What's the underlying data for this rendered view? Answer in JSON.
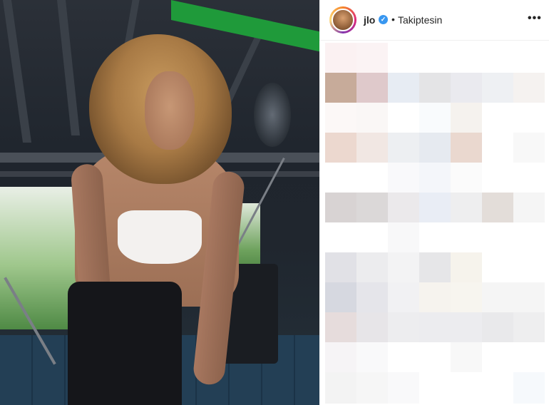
{
  "post": {
    "username": "jlo",
    "verified_mark": "✓",
    "separator": "•",
    "follow_status": "Takiptesin",
    "more_icon": "•••"
  },
  "icons": [
    "verified-badge-icon",
    "more-options-icon"
  ],
  "colors": {
    "verified_blue": "#3897f0",
    "text": "#262626",
    "green_beam": "#1f9a3a"
  },
  "blurred_rows": [
    [
      "#fbf1f2",
      "#fbf3f4",
      "#ffffff",
      "#ffffff",
      "#ffffff",
      "#ffffff",
      "#ffffff"
    ],
    [
      "#c7ab9a",
      "#dfc9cb",
      "#e7ecf3",
      "#e4e4e6",
      "#eaeaef",
      "#eef0f3",
      "#f5f2f0"
    ],
    [
      "#fcf8f7",
      "#faf7f6",
      "#ffffff",
      "#f9fbfd",
      "#f5f2ee",
      "#ffffff",
      "#ffffff"
    ],
    [
      "#ecd8cf",
      "#f1e7e3",
      "#edeff2",
      "#e6eaf0",
      "#ead8cf",
      "#ffffff",
      "#f8f8f8"
    ],
    [
      "#ffffff",
      "#ffffff",
      "#f9f9fb",
      "#f4f6fa",
      "#fbfbfb",
      "#ffffff",
      "#ffffff"
    ],
    [
      "#d8d3d3",
      "#dbd8d8",
      "#ebe9eb",
      "#e9edf5",
      "#eeeeef",
      "#e3ddd9",
      "#f5f5f5"
    ],
    [
      "#ffffff",
      "#ffffff",
      "#f8f8f9",
      "#ffffff",
      "#ffffff",
      "#ffffff",
      "#ffffff"
    ],
    [
      "#e1e1e6",
      "#ececee",
      "#f3f3f4",
      "#e6e6e8",
      "#f6f3ec",
      "#ffffff",
      "#ffffff"
    ],
    [
      "#d6d8e0",
      "#e5e5ea",
      "#f1f1f3",
      "#f6f3ee",
      "#f7f5ef",
      "#f5f5f5",
      "#f5f5f5"
    ],
    [
      "#e6dcdc",
      "#e7e5e8",
      "#ededef",
      "#ececef",
      "#ececef",
      "#e9e9eb",
      "#eeeeef"
    ],
    [
      "#f6f4f6",
      "#f9f9fa",
      "#ffffff",
      "#ffffff",
      "#f8f8f8",
      "#ffffff",
      "#ffffff"
    ],
    [
      "#f3f3f3",
      "#f6f6f6",
      "#f9f9fa",
      "#ffffff",
      "#ffffff",
      "#ffffff",
      "#f6f9fc"
    ]
  ]
}
